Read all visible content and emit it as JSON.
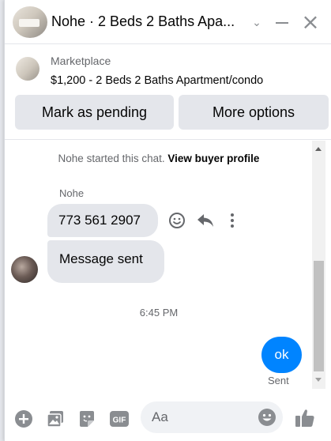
{
  "header": {
    "title": "Nohe · 2 Beds 2 Baths Apa...",
    "chevron_icon": "chevron-down-icon",
    "minimize_icon": "minimize-icon",
    "close_icon": "close-icon",
    "close_glyph": "×",
    "chevron_glyph": "⌄"
  },
  "listing": {
    "source_label": "Marketplace",
    "title": "$1,200 - 2 Beds 2 Baths Apartment/condo",
    "mark_pending_label": "Mark as pending",
    "more_options_label": "More options"
  },
  "chat": {
    "system_message": "Nohe started this chat.",
    "view_profile_label": "View buyer profile",
    "sender_name": "Nohe",
    "messages": [
      {
        "from": "Nohe",
        "text": "773 561 2907"
      },
      {
        "from": "Nohe",
        "text": "Message sent"
      }
    ],
    "timestamp": "6:45 PM",
    "outgoing": {
      "text": "ok",
      "status": "Sent"
    }
  },
  "composer": {
    "placeholder": "Aa",
    "icons": [
      "add-icon",
      "photo-icon",
      "sticker-icon",
      "gif-icon",
      "emoji-icon",
      "thumbs-up-icon"
    ],
    "gif_label": "GIF"
  },
  "colors": {
    "accent": "#0084ff",
    "icon_gray": "#8a8d91",
    "bubble_gray": "#e4e6eb",
    "secondary_text": "#65676b"
  }
}
